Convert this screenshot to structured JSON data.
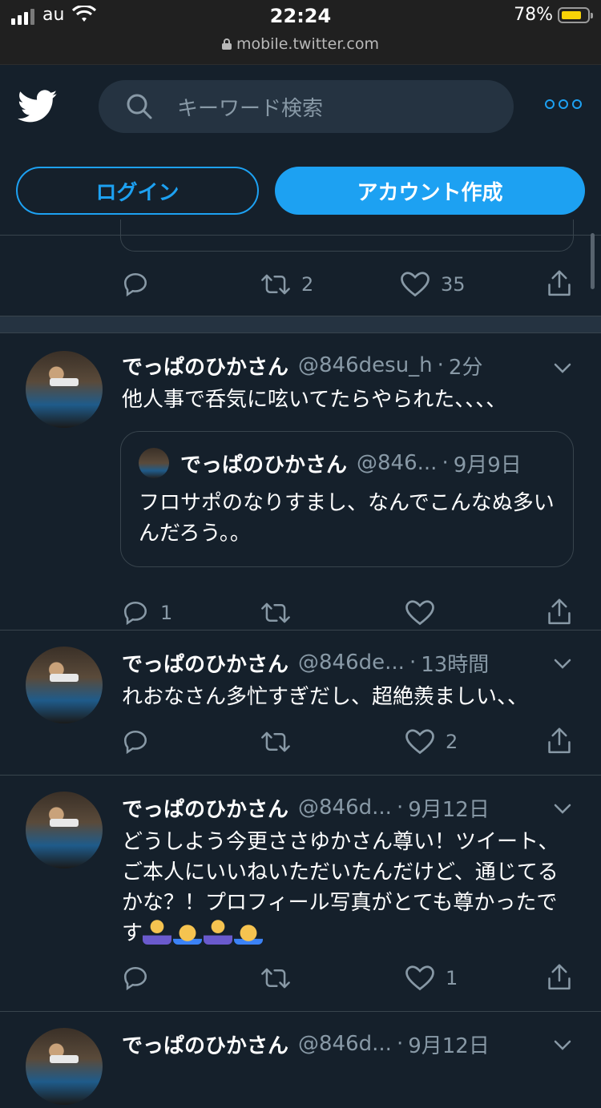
{
  "status_bar": {
    "carrier": "au",
    "time": "22:24",
    "battery": "78%",
    "url": "mobile.twitter.com"
  },
  "header": {
    "search_placeholder": "キーワード検索",
    "login_label": "ログイン",
    "signup_label": "アカウント作成"
  },
  "stub_tweet": {
    "retweets": "2",
    "likes": "35"
  },
  "tweets": [
    {
      "name": "でっぱのひかさん",
      "handle": "@846desu_h",
      "time": "2分",
      "text": "他人事で呑気に呟いてたらやられた、、、、",
      "quote": {
        "name": "でっぱのひかさん",
        "handle": "@846...",
        "time": "9月9日",
        "text": "フロサポのなりすまし、なんでこんなぬ多いんだろう。。"
      },
      "replies": "1",
      "retweets": "",
      "likes": ""
    },
    {
      "name": "でっぱのひかさん",
      "handle": "@846de...",
      "time": "13時間",
      "text": "れおなさん多忙すぎだし、超絶羨ましい、、",
      "replies": "",
      "retweets": "",
      "likes": "2"
    },
    {
      "name": "でっぱのひかさん",
      "handle": "@846d...",
      "time": "9月12日",
      "text": "どうしよう今更ささゆかさん尊い！ツイート、ご本人にいいねいただいたんだけど、通じてるかな？！プロフィール写真がとても尊かったです",
      "replies": "",
      "retweets": "",
      "likes": "1"
    },
    {
      "name": "でっぱのひかさん",
      "handle": "@846d...",
      "time": "9月12日"
    }
  ]
}
